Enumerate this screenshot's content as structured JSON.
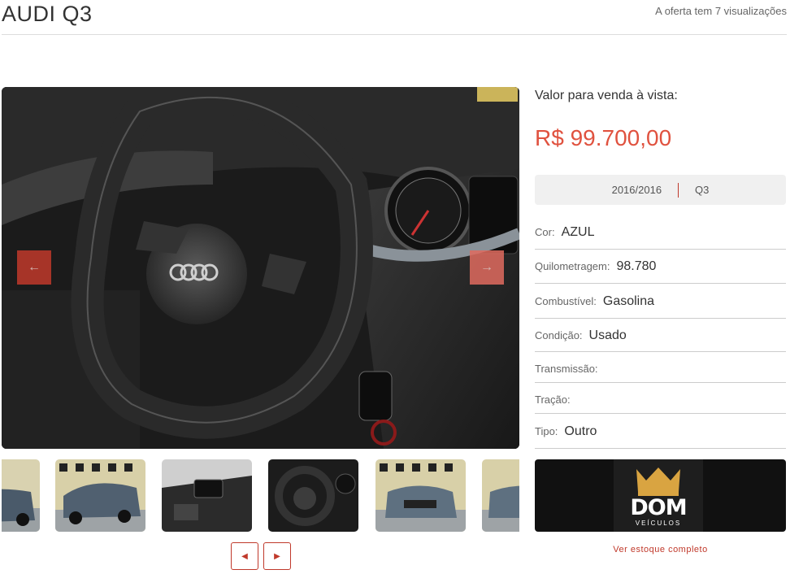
{
  "header": {
    "title": "AUDI Q3",
    "views_text": "A oferta tem 7 visualizações"
  },
  "gallery": {
    "prev_arrow": "←",
    "next_arrow": "→",
    "pager_prev": "◀",
    "pager_next": "▶"
  },
  "pricing": {
    "label": "Valor para venda à vista:",
    "price": "R$ 99.700,00"
  },
  "meta": {
    "year": "2016/2016",
    "model": "Q3"
  },
  "specs": [
    {
      "key": "Cor:",
      "value": "AZUL"
    },
    {
      "key": "Quilometragem:",
      "value": "98.780"
    },
    {
      "key": "Combustível:",
      "value": "Gasolina"
    },
    {
      "key": "Condição:",
      "value": "Usado"
    },
    {
      "key": "Transmissão:",
      "value": ""
    },
    {
      "key": "Tração:",
      "value": ""
    },
    {
      "key": "Tipo:",
      "value": "Outro"
    }
  ],
  "dealer": {
    "name": "DOM",
    "subtitle": "VEÍCULOS",
    "stock_link": "Ver estoque completo"
  },
  "colors": {
    "accent": "#e0523f",
    "arrow": "#c0392b"
  }
}
